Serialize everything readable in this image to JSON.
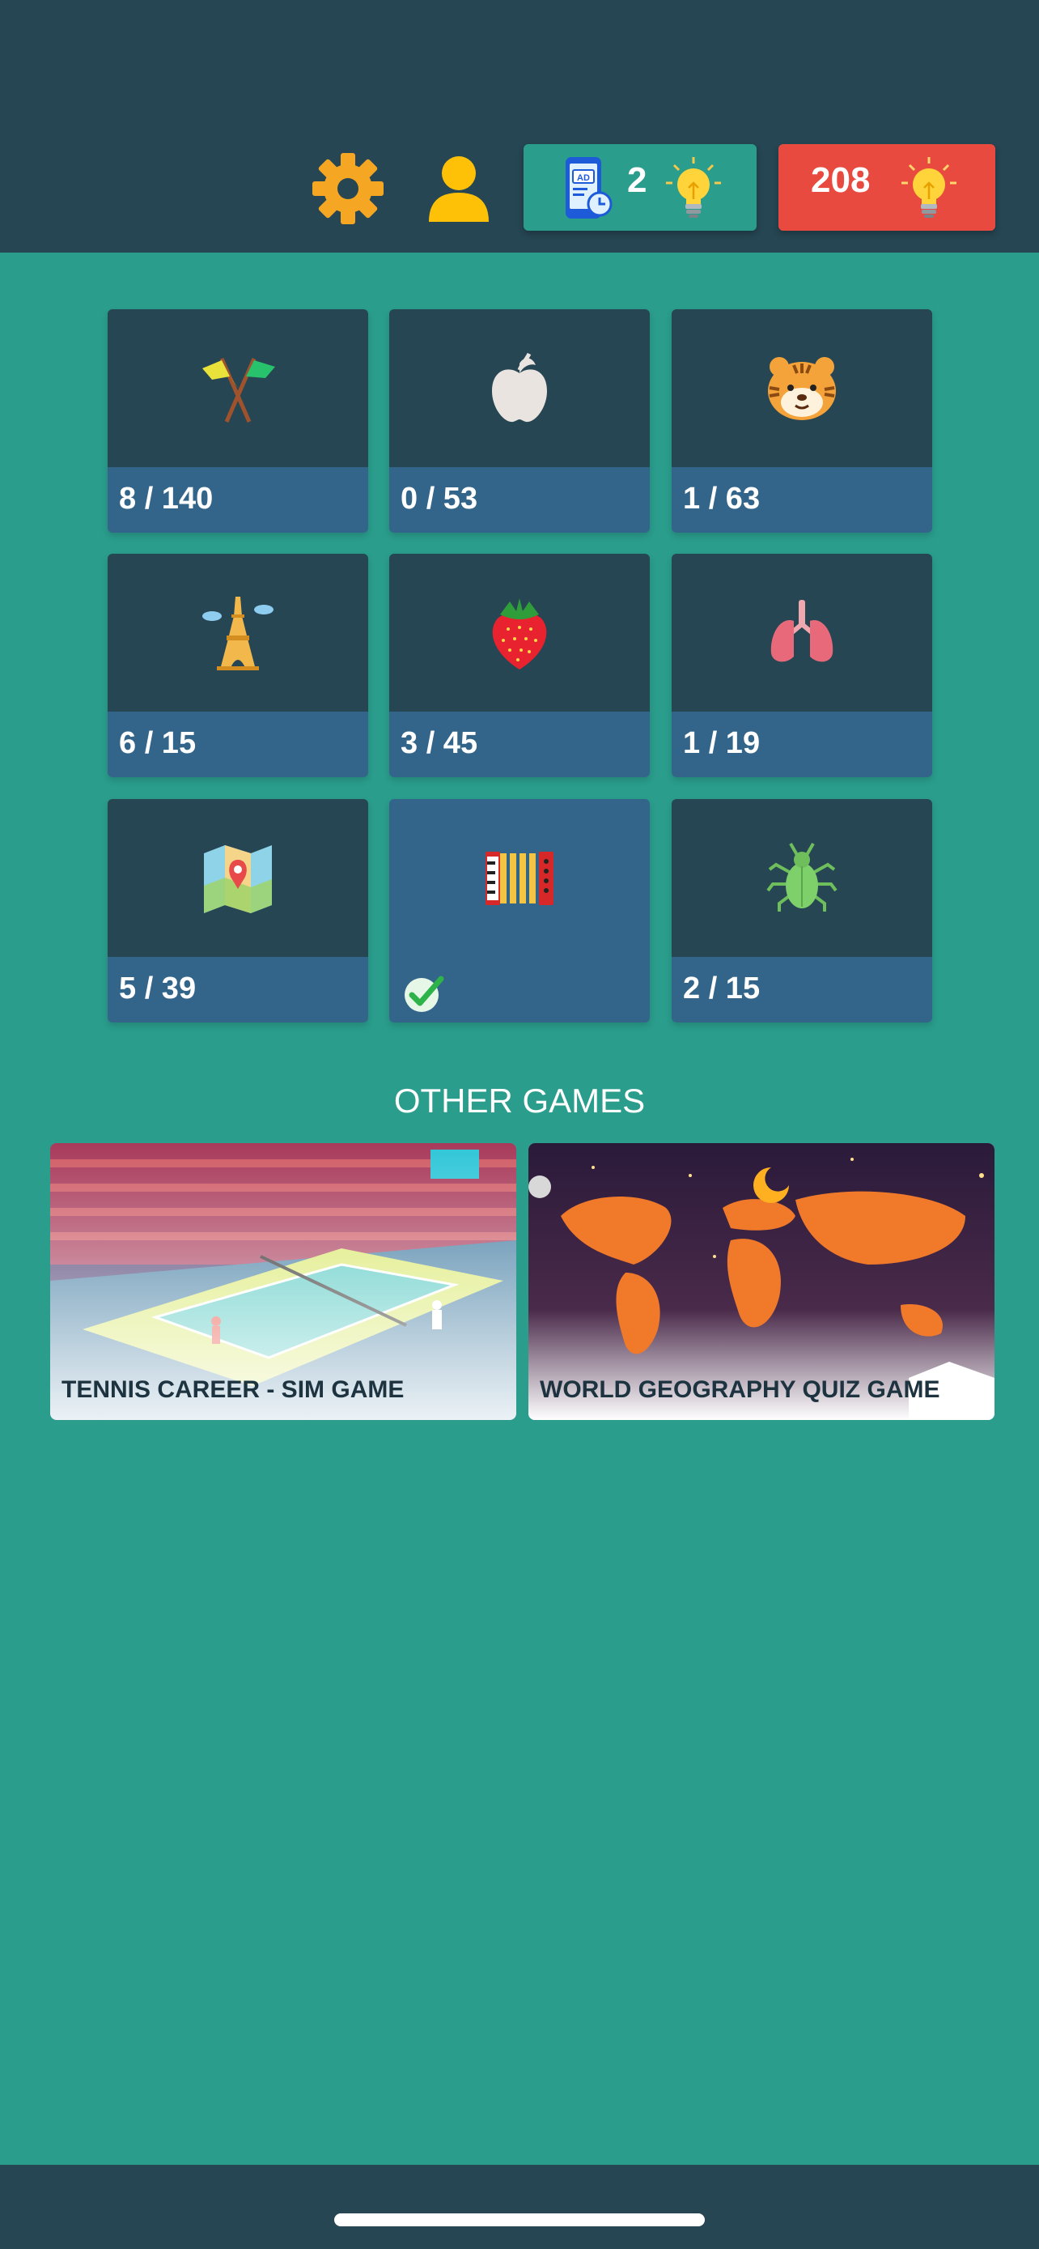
{
  "header": {
    "ad_hints": "2",
    "coins": "208",
    "colors": {
      "bar": "#264653",
      "ad_pill": "#2a9d8c",
      "coins_pill": "#e84a3f"
    },
    "icons": [
      "gear-icon",
      "user-icon",
      "watch-ad-icon",
      "lightbulb-icon"
    ]
  },
  "categories": [
    {
      "icon": "crossed-flags-icon",
      "progress": "8 / 140",
      "completed": false
    },
    {
      "icon": "apple-icon",
      "progress": "0 / 53",
      "completed": false
    },
    {
      "icon": "tiger-face-icon",
      "progress": "1 / 63",
      "completed": false
    },
    {
      "icon": "eiffel-tower-icon",
      "progress": "6 / 15",
      "completed": false
    },
    {
      "icon": "strawberry-icon",
      "progress": "3 / 45",
      "completed": false
    },
    {
      "icon": "lungs-icon",
      "progress": "1 / 19",
      "completed": false
    },
    {
      "icon": "map-icon",
      "progress": "5 / 39",
      "completed": false
    },
    {
      "icon": "accordion-icon",
      "progress": "",
      "completed": true
    },
    {
      "icon": "bug-icon",
      "progress": "2 / 15",
      "completed": false
    }
  ],
  "other_games": {
    "title": "OTHER GAMES",
    "games": [
      {
        "title": "TENNIS CAREER - SIM GAME"
      },
      {
        "title": "WORLD GEOGRAPHY QUIZ GAME"
      }
    ]
  }
}
